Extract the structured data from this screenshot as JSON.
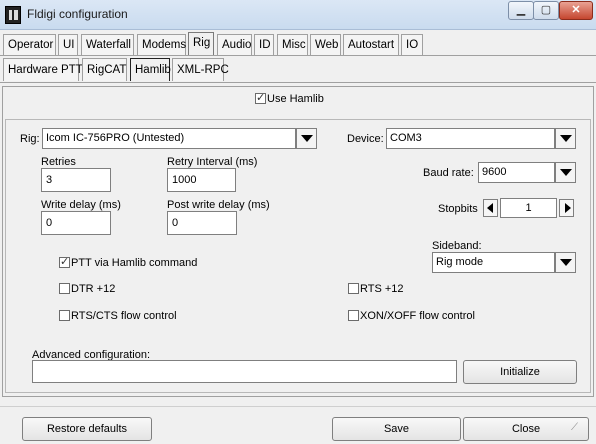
{
  "window": {
    "title": "Fldigi configuration",
    "min_label": "▁",
    "max_label": "▢",
    "close_label": "✕"
  },
  "tabs_row1": [
    "Operator",
    "UI",
    "Waterfall",
    "Modems",
    "Rig",
    "Audio",
    "ID",
    "Misc",
    "Web",
    "Autostart",
    "IO"
  ],
  "tabs_row1_active": "Rig",
  "tabs_row2": [
    "Hardware PTT",
    "RigCAT",
    "Hamlib",
    "XML-RPC"
  ],
  "tabs_row2_active": "Hamlib",
  "hamlib": {
    "use_hamlib_label": "Use Hamlib",
    "use_hamlib": true,
    "rig_label": "Rig:",
    "rig_value": "Icom IC-756PRO  (Untested)",
    "device_label": "Device:",
    "device_value": "COM3",
    "retries_label": "Retries",
    "retries_value": "3",
    "retry_interval_label": "Retry Interval (ms)",
    "retry_interval_value": "1000",
    "write_delay_label": "Write delay (ms)",
    "write_delay_value": "0",
    "post_write_delay_label": "Post write delay (ms)",
    "post_write_delay_value": "0",
    "baud_label": "Baud rate:",
    "baud_value": "9600",
    "stopbits_label": "Stopbits",
    "stopbits_value": "1",
    "sideband_label": "Sideband:",
    "sideband_value": "Rig mode",
    "ptt_label": "PTT via Hamlib command",
    "ptt": true,
    "dtr_label": "DTR +12",
    "dtr": false,
    "rts_label": "RTS +12",
    "rts": false,
    "rtscts_label": "RTS/CTS flow control",
    "rtscts": false,
    "xonxoff_label": "XON/XOFF flow control",
    "xonxoff": false,
    "advanced_label": "Advanced configuration:",
    "advanced_value": "",
    "initialize_label": "Initialize"
  },
  "footer": {
    "restore_label": "Restore defaults",
    "save_label": "Save",
    "close_label": "Close"
  }
}
